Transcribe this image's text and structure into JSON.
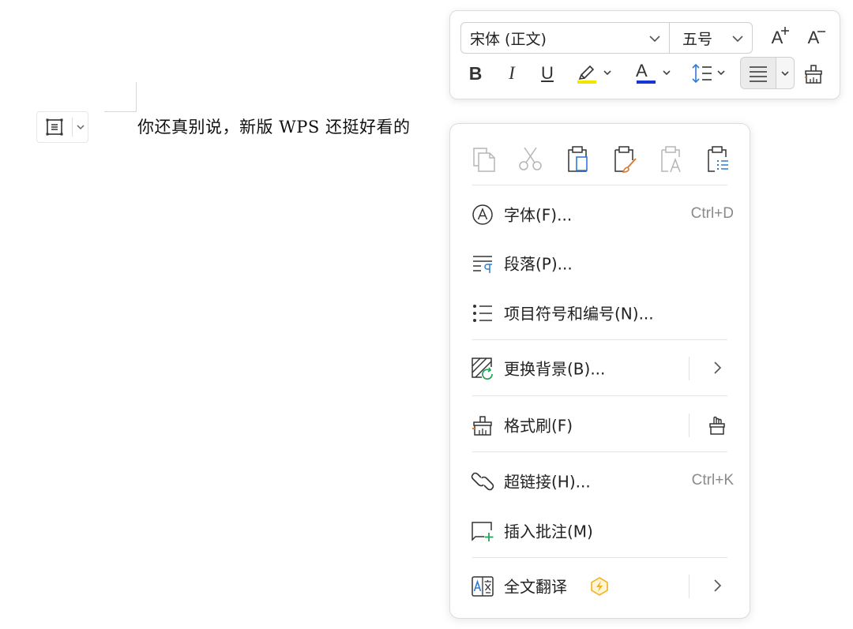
{
  "document": {
    "text": "你还真别说，新版 WPS 还挺好看的"
  },
  "mini_toolbar": {
    "font_name": "宋体 (正文)",
    "font_size": "五号",
    "grow_font": "A",
    "shrink_font": "A",
    "bold": "B",
    "italic": "I",
    "underline": "U",
    "font_color_letter": "A",
    "colors": {
      "highlight": "#f2e600",
      "font_color": "#1a35d6",
      "accent_blue": "#2e7bd6"
    }
  },
  "context_menu": {
    "clipboard_icons": [
      "copy-icon",
      "cut-icon",
      "paste-icon",
      "paste-keep-format-icon",
      "paste-text-only-icon",
      "paste-special-icon"
    ],
    "items": [
      {
        "label": "字体(F)...",
        "shortcut": "Ctrl+D",
        "icon": "font-icon"
      },
      {
        "label": "段落(P)...",
        "icon": "paragraph-icon"
      },
      {
        "label": "项目符号和编号(N)...",
        "icon": "bullet-list-icon"
      },
      {
        "label": "更换背景(B)...",
        "icon": "background-icon",
        "submenu": true
      },
      {
        "label": "格式刷(F)",
        "icon": "format-painter-icon"
      },
      {
        "label": "超链接(H)...",
        "shortcut": "Ctrl+K",
        "icon": "link-icon"
      },
      {
        "label": "插入批注(M)",
        "icon": "comment-icon"
      },
      {
        "label": "全文翻译",
        "icon": "translate-icon",
        "submenu": true,
        "premium": true
      }
    ],
    "colors": {
      "icon_gray": "#555555",
      "disabled_gray": "#b5b5b5",
      "orange": "#e07a2e",
      "green": "#22a35a",
      "premium_gold": "#f2b21b"
    }
  }
}
